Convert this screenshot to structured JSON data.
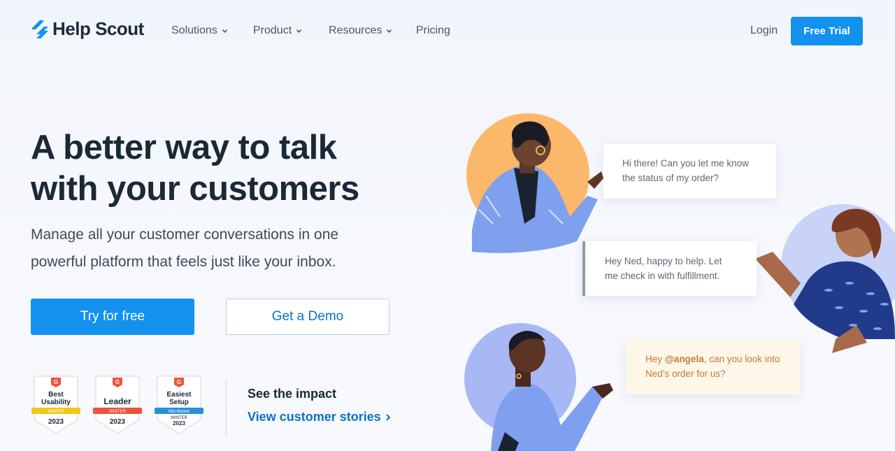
{
  "nav": {
    "logo_text": "Help Scout",
    "items": [
      {
        "label": "Solutions",
        "dropdown": true
      },
      {
        "label": "Product",
        "dropdown": true
      },
      {
        "label": "Resources",
        "dropdown": true
      },
      {
        "label": "Pricing",
        "dropdown": false
      }
    ],
    "login": "Login",
    "cta": "Free Trial"
  },
  "hero": {
    "title_line1": "A better way to talk",
    "title_line2": "with your customers",
    "subtitle_line1": "Manage all your customer conversations in one",
    "subtitle_line2": "powerful platform that feels just like your inbox.",
    "primary_button": "Try for free",
    "secondary_button": "Get a Demo"
  },
  "badges": [
    {
      "line1": "Best",
      "line2": "Usability",
      "ribbon": "WINTER",
      "year": "2023",
      "ribbon_color": "#f5c518"
    },
    {
      "line1": "Leader",
      "line2": "",
      "ribbon": "WINTER",
      "year": "2023",
      "ribbon_color": "#f0523a"
    },
    {
      "line1": "Easiest",
      "line2": "Setup",
      "ribbon": "Mid-Market",
      "ribbon2": "WINTER",
      "year": "2023",
      "ribbon_color": "#2a8fd8"
    }
  ],
  "impact": {
    "title": "See the impact",
    "link": "View customer stories"
  },
  "chat": {
    "message1": "Hi there! Can you let me know the status of my order?",
    "message2": "Hey Ned, happy to help. Let me check in with fulfillment.",
    "message3_prefix": "Hey ",
    "message3_mention": "@angela",
    "message3_suffix": ", can you look into Ned’s order for us?"
  },
  "colors": {
    "brand_blue": "#1292ee",
    "link_blue": "#0b72c9",
    "heading": "#1b2836",
    "logo_icon": "#1292ee"
  }
}
